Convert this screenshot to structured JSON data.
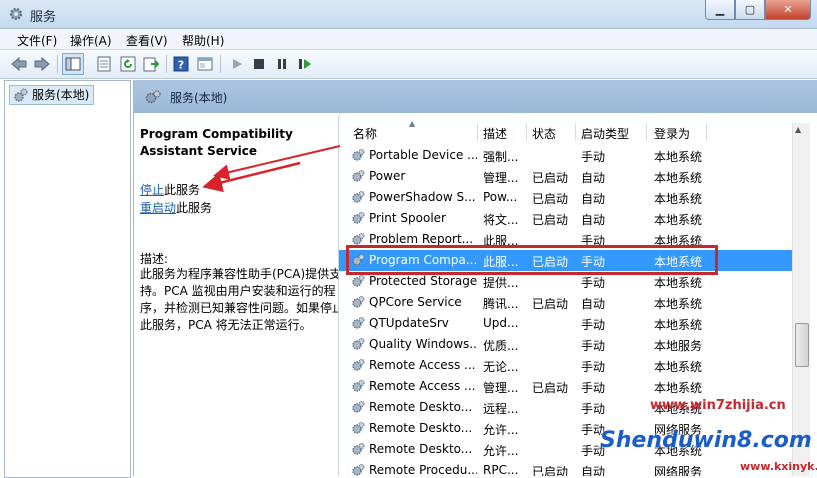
{
  "window": {
    "title": "服务"
  },
  "menu": {
    "items": [
      "文件(F)",
      "操作(A)",
      "查看(V)",
      "帮助(H)"
    ]
  },
  "tree": {
    "root": "服务(本地)"
  },
  "pane": {
    "header": "服务(本地)"
  },
  "detail": {
    "title": "Program Compatibility Assistant Service",
    "stop_link": "停止",
    "stop_suffix": "此服务",
    "restart_link": "重启动",
    "restart_suffix": "此服务",
    "desc_label": "描述:",
    "desc_text": "此服务为程序兼容性助手(PCA)提供支持。PCA 监视由用户安装和运行的程序，并检测已知兼容性问题。如果停止此服务，PCA 将无法正常运行。"
  },
  "list": {
    "headers": [
      "名称",
      "描述",
      "状态",
      "启动类型",
      "登录为"
    ],
    "rows": [
      {
        "name": "Portable Device ...",
        "desc": "强制...",
        "status": "",
        "startup": "手动",
        "logon": "本地系统"
      },
      {
        "name": "Power",
        "desc": "管理...",
        "status": "已启动",
        "startup": "自动",
        "logon": "本地系统"
      },
      {
        "name": "PowerShadow S...",
        "desc": "Pow...",
        "status": "已启动",
        "startup": "自动",
        "logon": "本地系统"
      },
      {
        "name": "Print Spooler",
        "desc": "将文...",
        "status": "已启动",
        "startup": "自动",
        "logon": "本地系统"
      },
      {
        "name": "Problem Report...",
        "desc": "此服...",
        "status": "",
        "startup": "手动",
        "logon": "本地系统"
      },
      {
        "name": "Program Compa...",
        "desc": "此服...",
        "status": "已启动",
        "startup": "手动",
        "logon": "本地系统"
      },
      {
        "name": "Protected Storage",
        "desc": "提供...",
        "status": "",
        "startup": "手动",
        "logon": "本地系统"
      },
      {
        "name": "QPCore Service",
        "desc": "腾讯...",
        "status": "已启动",
        "startup": "自动",
        "logon": "本地系统"
      },
      {
        "name": "QTUpdateSrv",
        "desc": "Upd...",
        "status": "",
        "startup": "手动",
        "logon": "本地系统"
      },
      {
        "name": "Quality Windows...",
        "desc": "优质...",
        "status": "",
        "startup": "手动",
        "logon": "本地服务"
      },
      {
        "name": "Remote Access ...",
        "desc": "无论...",
        "status": "",
        "startup": "手动",
        "logon": "本地系统"
      },
      {
        "name": "Remote Access ...",
        "desc": "管理...",
        "status": "已启动",
        "startup": "手动",
        "logon": "本地系统"
      },
      {
        "name": "Remote Deskto...",
        "desc": "远程...",
        "status": "",
        "startup": "手动",
        "logon": "本地系统"
      },
      {
        "name": "Remote Deskto...",
        "desc": "允许...",
        "status": "",
        "startup": "手动",
        "logon": "网络服务"
      },
      {
        "name": "Remote Deskto...",
        "desc": "允许...",
        "status": "",
        "startup": "手动",
        "logon": "本地系统"
      },
      {
        "name": "Remote Procedu...",
        "desc": "RPC...",
        "status": "已启动",
        "startup": "自动",
        "logon": "网络服务"
      }
    ]
  },
  "watermark": {
    "url": "www.win7zhijia.cn",
    "brand": "Shenduwin8.com",
    "sub": "www.kxinyk.com"
  }
}
